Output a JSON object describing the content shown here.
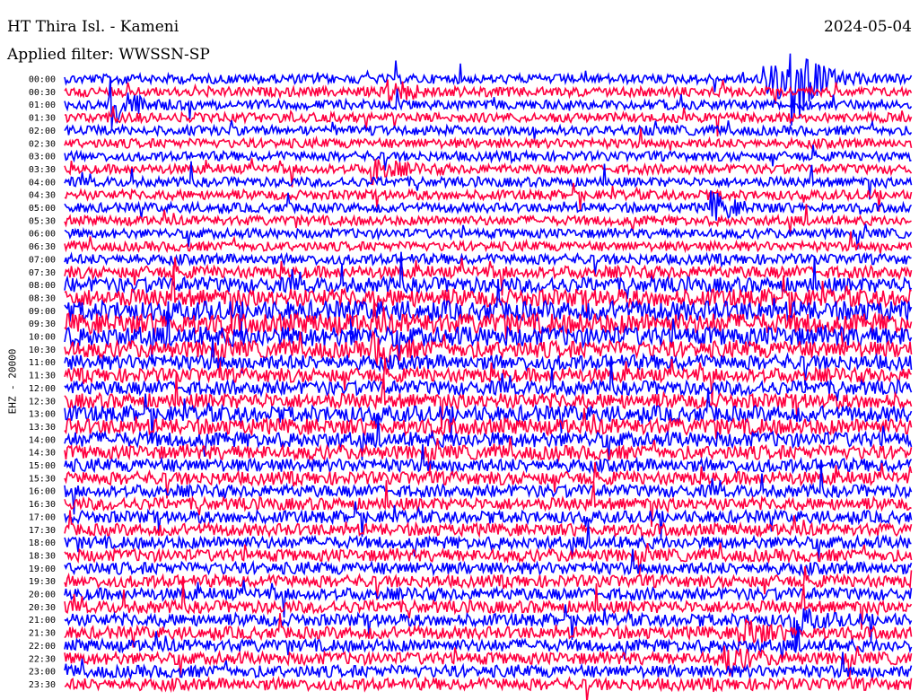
{
  "header": {
    "station": "HT Thira Isl. - Kameni",
    "filter": "Applied filter: WWSSN-SP",
    "date": "2024-05-04"
  },
  "chart_data": {
    "type": "line",
    "channel_label": "EHZ - 20000",
    "y_tick_labels": [
      "00:00",
      "00:30",
      "01:00",
      "01:30",
      "02:00",
      "02:30",
      "03:00",
      "03:30",
      "04:00",
      "04:30",
      "05:00",
      "05:30",
      "06:00",
      "06:30",
      "07:00",
      "07:30",
      "08:00",
      "08:30",
      "09:00",
      "09:30",
      "10:00",
      "10:30",
      "11:00",
      "11:30",
      "12:00",
      "12:30",
      "13:00",
      "13:30",
      "14:00",
      "14:30",
      "15:00",
      "15:30",
      "16:00",
      "16:30",
      "17:00",
      "17:30",
      "18:00",
      "18:30",
      "19:00",
      "19:30",
      "20:00",
      "20:30",
      "21:00",
      "21:30",
      "22:00",
      "22:30",
      "23:00",
      "23:30"
    ],
    "trace_minutes": 30,
    "series_colors": [
      "#0000ff",
      "#ff0040"
    ],
    "noise_amplitude_by_row": [
      1.0,
      1.0,
      1.0,
      1.0,
      1.0,
      1.0,
      1.0,
      1.0,
      1.0,
      1.0,
      1.0,
      1.0,
      1.0,
      1.0,
      1.1,
      1.3,
      1.6,
      1.9,
      2.1,
      2.2,
      2.1,
      1.8,
      1.6,
      1.5,
      1.5,
      1.6,
      1.7,
      1.7,
      1.6,
      1.5,
      1.4,
      1.4,
      1.3,
      1.3,
      1.3,
      1.3,
      1.3,
      1.3,
      1.3,
      1.3,
      1.3,
      1.3,
      1.3,
      1.3,
      1.3,
      1.3,
      1.3,
      1.3
    ],
    "events": [
      {
        "row": 0,
        "minute": 25.8,
        "amplitude": 9.0
      },
      {
        "row": 0,
        "minute": 25.0,
        "amplitude": 5.0
      },
      {
        "row": 2,
        "minute": 1.7,
        "amplitude": 4.5
      },
      {
        "row": 1,
        "minute": 11.5,
        "amplitude": 2.5
      },
      {
        "row": 7,
        "minute": 11.0,
        "amplitude": 2.5
      },
      {
        "row": 10,
        "minute": 23.0,
        "amplitude": 2.5
      },
      {
        "row": 21,
        "minute": 11.0,
        "amplitude": 2.0
      },
      {
        "row": 42,
        "minute": 25.8,
        "amplitude": 3.0
      },
      {
        "row": 43,
        "minute": 24.0,
        "amplitude": 3.0
      },
      {
        "row": 45,
        "minute": 23.5,
        "amplitude": 2.5
      }
    ]
  }
}
